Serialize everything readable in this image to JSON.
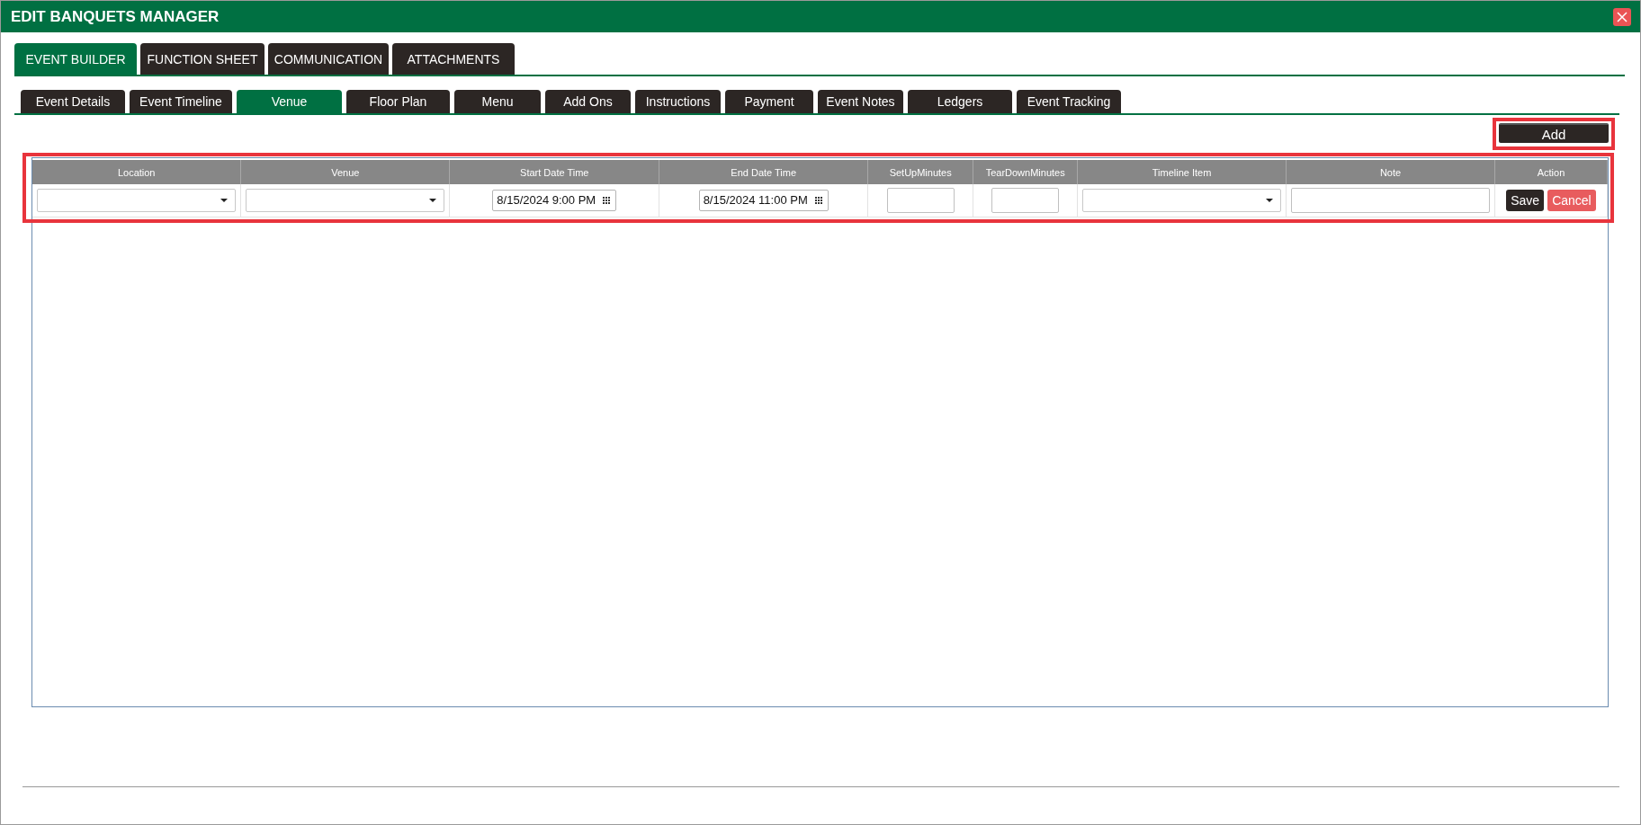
{
  "window": {
    "title": "EDIT BANQUETS MANAGER"
  },
  "main_tabs": [
    {
      "label": "EVENT BUILDER",
      "selected": true
    },
    {
      "label": "FUNCTION SHEET",
      "selected": false
    },
    {
      "label": "COMMUNICATION",
      "selected": false
    },
    {
      "label": "ATTACHMENTS",
      "selected": false
    }
  ],
  "sub_tabs": [
    {
      "label": "Event Details",
      "selected": false
    },
    {
      "label": "Event Timeline",
      "selected": false
    },
    {
      "label": "Venue",
      "selected": true
    },
    {
      "label": "Floor Plan",
      "selected": false
    },
    {
      "label": "Menu",
      "selected": false
    },
    {
      "label": "Add Ons",
      "selected": false
    },
    {
      "label": "Instructions",
      "selected": false
    },
    {
      "label": "Payment",
      "selected": false
    },
    {
      "label": "Event Notes",
      "selected": false
    },
    {
      "label": "Ledgers",
      "selected": false
    },
    {
      "label": "Event Tracking",
      "selected": false
    }
  ],
  "add_button": "Add",
  "table": {
    "columns": [
      "Location",
      "Venue",
      "Start Date Time",
      "End Date Time",
      "SetUpMinutes",
      "TearDownMinutes",
      "Timeline Item",
      "Note",
      "Action"
    ],
    "rows": [
      {
        "cells": [
          {
            "kind": "dropdown"
          },
          {
            "kind": "dropdown"
          },
          {
            "kind": "datetime",
            "value": "8/15/2024 9:00 PM"
          },
          {
            "kind": "datetime",
            "value": "8/15/2024 11:00 PM"
          },
          {
            "kind": "number"
          },
          {
            "kind": "number"
          },
          {
            "kind": "dropdown"
          },
          {
            "kind": "text"
          },
          {
            "kind": "actions",
            "buttons": [
              {
                "label": "Save",
                "kind": "primary"
              },
              {
                "label": "Cancel",
                "kind": "danger"
              }
            ]
          }
        ]
      }
    ]
  }
}
